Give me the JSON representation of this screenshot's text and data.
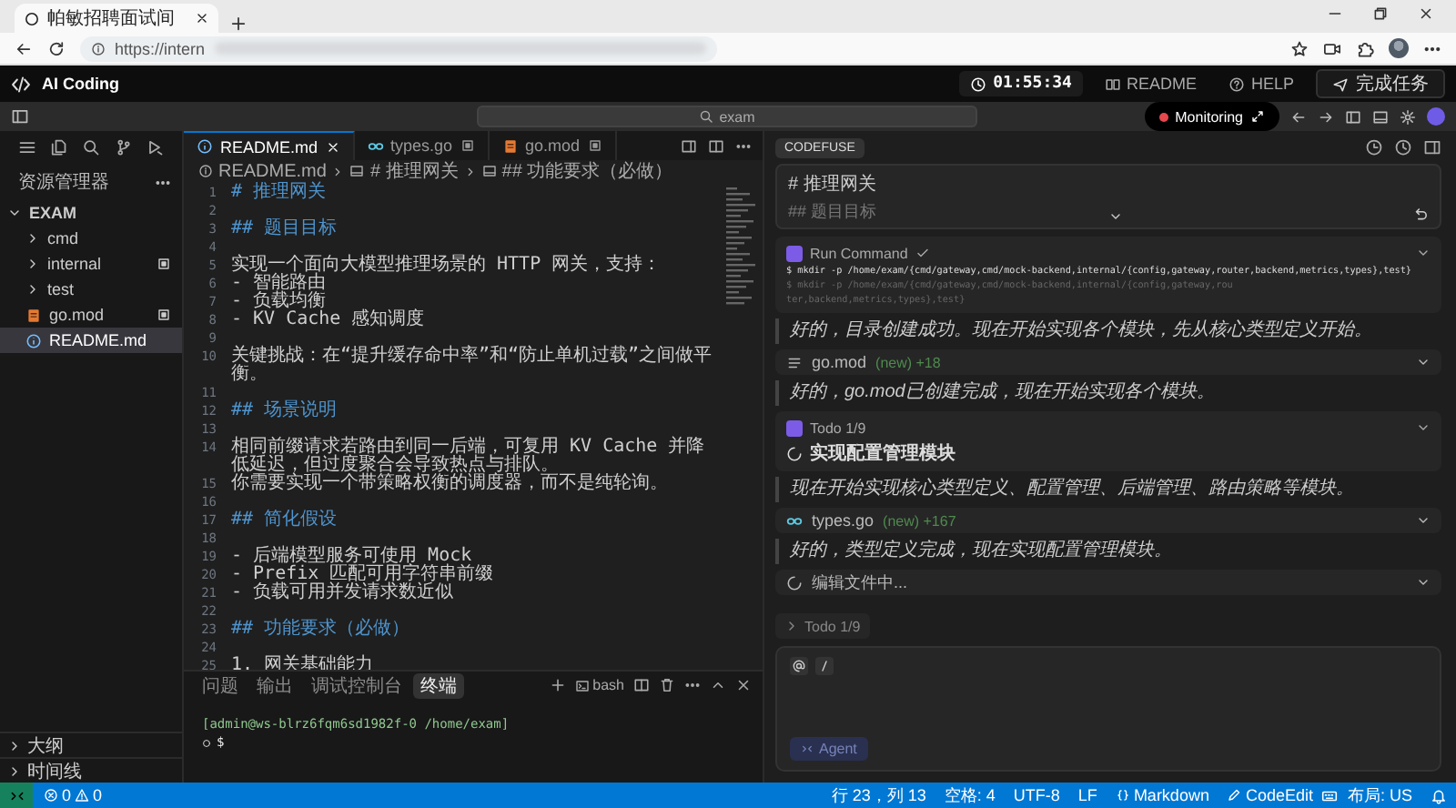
{
  "browser": {
    "tab_title": "帕敏招聘面试间",
    "url": "https://intern"
  },
  "header": {
    "app_name": "AI Coding",
    "timer": "01:55:34",
    "links": [
      {
        "label": "README",
        "kind": "readme"
      },
      {
        "label": "HELP",
        "kind": "help"
      }
    ],
    "finish_button": "完成任务"
  },
  "toolbar": {
    "search": {
      "value": "exam"
    },
    "monitoring": {
      "label": "Monitoring",
      "recording": true
    }
  },
  "explorer": {
    "title": "资源管理器",
    "root": {
      "label": "EXAM",
      "expanded": true,
      "children": [
        {
          "label": "cmd",
          "kind": "folder",
          "expanded": false,
          "selected": false,
          "modified": false
        },
        {
          "label": "internal",
          "kind": "folder",
          "expanded": false,
          "selected": false,
          "modified": true
        },
        {
          "label": "test",
          "kind": "folder",
          "expanded": false,
          "selected": false,
          "modified": false
        },
        {
          "label": "go.mod",
          "kind": "mod",
          "selected": false,
          "modified": true
        },
        {
          "label": "README.md",
          "kind": "markdown",
          "selected": true,
          "modified": false
        }
      ]
    },
    "sections": [
      {
        "label": "大纲",
        "expanded": false
      },
      {
        "label": "时间线",
        "expanded": false
      }
    ]
  },
  "editor": {
    "tabs": [
      {
        "label": "README.md",
        "kind": "markdown",
        "selected": true,
        "modified": false
      },
      {
        "label": "types.go",
        "kind": "go",
        "selected": false,
        "modified": true
      },
      {
        "label": "go.mod",
        "kind": "mod",
        "selected": false,
        "modified": true
      }
    ],
    "breadcrumb": [
      "README.md",
      "# 推理网关",
      "## 功能要求（必做）"
    ],
    "lines": [
      {
        "number": "1",
        "kind": "heading",
        "text": "# 推理网关"
      },
      {
        "number": "2",
        "kind": "blank"
      },
      {
        "number": "3",
        "kind": "heading",
        "text": "## 题目目标"
      },
      {
        "number": "4",
        "kind": "blank"
      },
      {
        "number": "5",
        "kind": "text",
        "text": "实现一个面向大模型推理场景的 HTTP 网关，支持："
      },
      {
        "number": "6",
        "kind": "text",
        "text": "- 智能路由"
      },
      {
        "number": "7",
        "kind": "text",
        "text": "- 负载均衡"
      },
      {
        "number": "8",
        "kind": "text",
        "text": "- KV Cache 感知调度"
      },
      {
        "number": "9",
        "kind": "blank"
      },
      {
        "number": "10",
        "kind": "text",
        "text": "关键挑战：在“提升缓存命中率”和“防止单机过载”之间做平衡。"
      },
      {
        "number": "11",
        "kind": "blank"
      },
      {
        "number": "12",
        "kind": "heading",
        "text": "## 场景说明"
      },
      {
        "number": "13",
        "kind": "blank"
      },
      {
        "number": "14",
        "kind": "text",
        "text": "相同前缀请求若路由到同一后端，可复用 KV Cache 并降低延迟，但过度聚合会导致热点与排队。"
      },
      {
        "number": "15",
        "kind": "text",
        "text": "你需要实现一个带策略权衡的调度器，而不是纯轮询。"
      },
      {
        "number": "16",
        "kind": "blank"
      },
      {
        "number": "17",
        "kind": "heading",
        "text": "## 简化假设"
      },
      {
        "number": "18",
        "kind": "blank"
      },
      {
        "number": "19",
        "kind": "text",
        "text": "- 后端模型服务可使用 Mock"
      },
      {
        "number": "20",
        "kind": "text",
        "text": "- Prefix 匹配可用字符串前缀"
      },
      {
        "number": "21",
        "kind": "text",
        "text": "- 负载可用并发请求数近似"
      },
      {
        "number": "22",
        "kind": "blank"
      },
      {
        "number": "23",
        "kind": "heading",
        "text": "## 功能要求（必做）"
      },
      {
        "number": "24",
        "kind": "blank"
      },
      {
        "number": "25",
        "kind": "text",
        "text": "1. 网关基础能力"
      }
    ]
  },
  "terminal": {
    "tabs": [
      {
        "label": "问题",
        "selected": false
      },
      {
        "label": "输出",
        "selected": false
      },
      {
        "label": "调试控制台",
        "selected": false
      },
      {
        "label": "终端",
        "selected": true
      }
    ],
    "shell": "bash",
    "prompt": "[admin@ws-blrz6fqm6sd1982f-0 /home/exam]",
    "input_prompt": "$"
  },
  "assistant": {
    "tab": "CODEFUSE",
    "preview": [
      {
        "text": "# 推理网关",
        "faded": false
      },
      {
        "text": "## 题目目标",
        "faded": true
      }
    ],
    "items": [
      {
        "kind": "command",
        "title": "Run Command",
        "done": true,
        "command": "$ mkdir -p /home/exam/{cmd/gateway,cmd/mock-backend,internal/{config,gateway,router,backend,metrics,types},test}",
        "output": [
          "$ mkdir -p /home/exam/{cmd/gateway,cmd/mock-backend,internal/{config,gateway,rou",
          "ter,backend,metrics,types},test}"
        ]
      },
      {
        "kind": "message",
        "text": "好的，目录创建成功。现在开始实现各个模块，先从核心类型定义开始。"
      },
      {
        "kind": "modfile",
        "name": "go.mod",
        "status": "(new)",
        "diff": "+18"
      },
      {
        "kind": "message",
        "text": "好的，go.mod已创建完成，现在开始实现各个模块。"
      },
      {
        "kind": "todo",
        "title": "Todo",
        "count": "1/9",
        "task": {
          "text": "实现配置管理模块",
          "in_progress": true
        }
      },
      {
        "kind": "message",
        "text": "现在开始实现核心类型定义、配置管理、后端管理、路由策略等模块。"
      },
      {
        "kind": "gofile",
        "name": "types.go",
        "status": "(new)",
        "diff": "+167"
      },
      {
        "kind": "message",
        "text": "好的，类型定义完成，现在实现配置管理模块。"
      },
      {
        "kind": "pending",
        "text": "编辑文件中..."
      }
    ],
    "todo_bar": {
      "title": "Todo",
      "count": "1/9",
      "expanded": false
    },
    "input": {
      "mode": "Agent"
    }
  },
  "status_bar": {
    "errors": "0",
    "warnings": "0",
    "items": [
      {
        "text": "行 23，列 13",
        "kind": "plain"
      },
      {
        "text": "空格: 4",
        "kind": "plain"
      },
      {
        "text": "UTF-8",
        "kind": "plain"
      },
      {
        "text": "LF",
        "kind": "plain"
      },
      {
        "text": "Markdown",
        "kind": "language"
      },
      {
        "text": "CodeEdit",
        "kind": "extension"
      },
      {
        "text": "布局: US",
        "kind": "layout"
      }
    ]
  }
}
